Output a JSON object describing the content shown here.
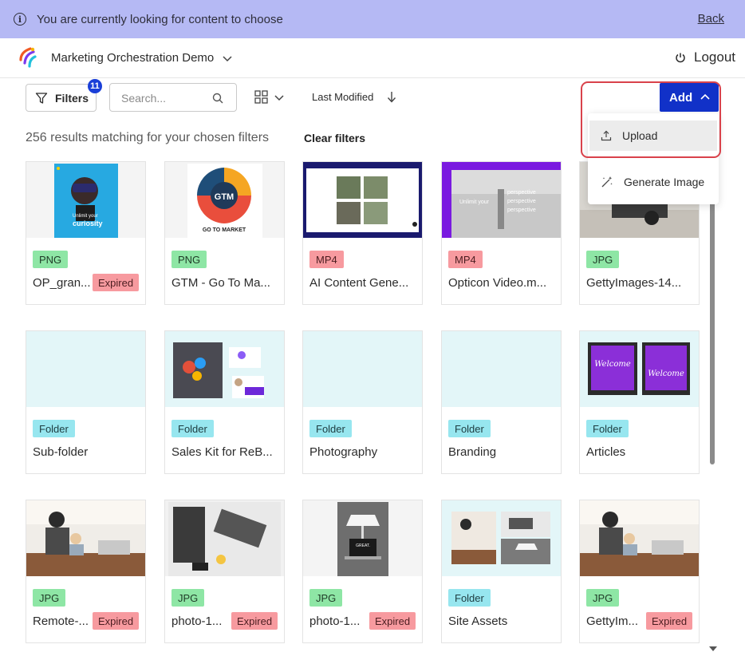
{
  "banner": {
    "message": "You are currently looking for content to choose",
    "back_label": "Back",
    "color": "#b5b9f4"
  },
  "header": {
    "workspace": "Marketing Orchestration Demo",
    "logout_label": "Logout"
  },
  "toolbar": {
    "filters_label": "Filters",
    "filters_count": "11",
    "search_placeholder": "Search...",
    "sort_label": "Last Modified",
    "add_label": "Add",
    "add_color": "#1131c8"
  },
  "results": {
    "summary": "256 results matching for your chosen filters",
    "clear_label": "Clear filters"
  },
  "add_menu": {
    "items": [
      {
        "label": "Upload",
        "icon": "upload-icon"
      },
      {
        "label": "Generate Image",
        "icon": "magic-wand-icon"
      }
    ]
  },
  "items": [
    {
      "type": "PNG",
      "name": "OP_gran...",
      "expired": "Expired"
    },
    {
      "type": "PNG",
      "name": "GTM - Go To Ma..."
    },
    {
      "type": "MP4",
      "name": "AI Content Gene..."
    },
    {
      "type": "MP4",
      "name": "Opticon Video.m..."
    },
    {
      "type": "JPG",
      "name": "GettyImages-14..."
    },
    {
      "type": "Folder",
      "name": "Sub-folder"
    },
    {
      "type": "Folder",
      "name": "Sales Kit for ReB..."
    },
    {
      "type": "Folder",
      "name": "Photography"
    },
    {
      "type": "Folder",
      "name": "Branding"
    },
    {
      "type": "Folder",
      "name": "Articles"
    },
    {
      "type": "JPG",
      "name": "Remote-...",
      "expired": "Expired"
    },
    {
      "type": "JPG",
      "name": "photo-1...",
      "expired": "Expired"
    },
    {
      "type": "JPG",
      "name": "photo-1...",
      "expired": "Expired"
    },
    {
      "type": "Folder",
      "name": "Site Assets"
    },
    {
      "type": "JPG",
      "name": "GettyIm...",
      "expired": "Expired"
    }
  ],
  "thumb_text": {
    "op_line1": "Unlimit your",
    "op_line2": "curiosity",
    "gtm_center": "GTM",
    "gtm_caption": "GO TO MARKET",
    "opticon_left": "Unlimit your",
    "opticon_r1": "perspective",
    "opticon_r2": "perspective",
    "opticon_r3": "perspective",
    "articles_word1": "Welcome",
    "articles_word2": "Welcome",
    "laptop_screen": "GREAT."
  }
}
